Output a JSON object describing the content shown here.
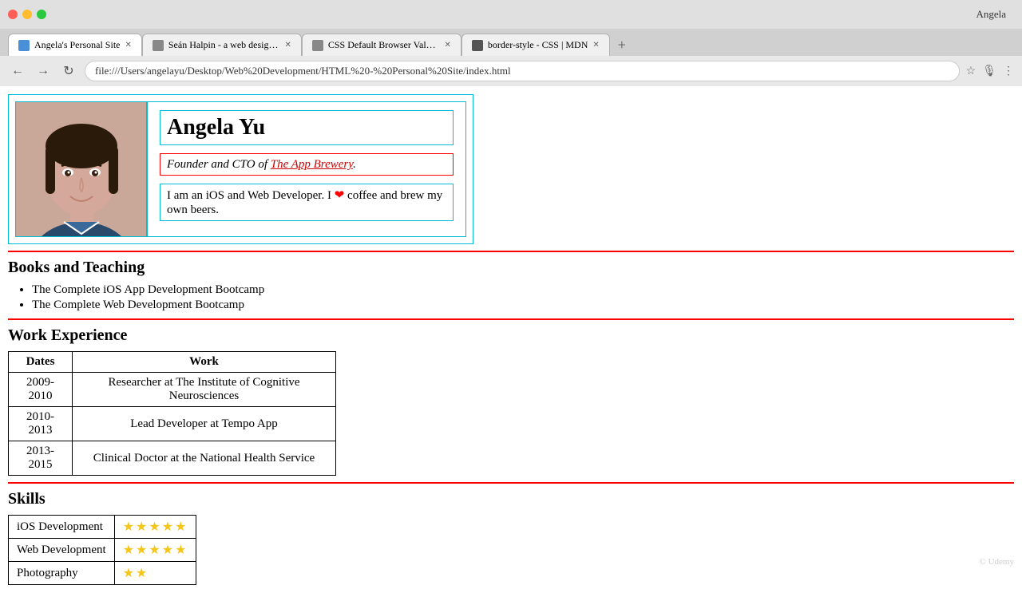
{
  "browser": {
    "titlebar": {
      "user": "Angela"
    },
    "tabs": [
      {
        "label": "Angela's Personal Site",
        "active": true,
        "favicon_color": "#4a90d9"
      },
      {
        "label": "Seán Halpin - a web designer...",
        "active": false,
        "favicon_color": "#4a90d9"
      },
      {
        "label": "CSS Default Browser Values fo...",
        "active": false,
        "favicon_color": "#4a90d9"
      },
      {
        "label": "border-style - CSS | MDN",
        "active": false,
        "favicon_color": "#4a90d9"
      }
    ],
    "address": "file:///Users/angelayu/Desktop/Web%20Development/HTML%20-%20Personal%20Site/index.html"
  },
  "page": {
    "profile": {
      "name": "Angela Yu",
      "title_prefix": "Founder and CTO of ",
      "title_link_text": "The App Brewery",
      "title_link_suffix": ".",
      "bio": "I am an iOS and Web Developer. I ❤️ coffee and brew my own beers."
    },
    "sections": {
      "books": {
        "heading": "Books and Teaching",
        "items": [
          "The Complete iOS App Development Bootcamp",
          "The Complete Web Development Bootcamp"
        ]
      },
      "work": {
        "heading": "Work Experience",
        "headers": [
          "Dates",
          "Work"
        ],
        "rows": [
          {
            "dates": "2009-2010",
            "work": "Researcher at The Institute of Cognitive Neurosciences"
          },
          {
            "dates": "2010-2013",
            "work": "Lead Developer at Tempo App"
          },
          {
            "dates": "2013-2015",
            "work": "Clinical Doctor at the National Health Service"
          }
        ]
      },
      "skills": {
        "heading": "Skills",
        "items": [
          {
            "skill": "iOS Development",
            "stars": 5,
            "max": 5
          },
          {
            "skill": "Web Development",
            "stars": 5,
            "max": 5
          },
          {
            "skill": "Photography",
            "stars": 2,
            "max": 5
          }
        ]
      }
    },
    "watermark": "© Udemy"
  }
}
